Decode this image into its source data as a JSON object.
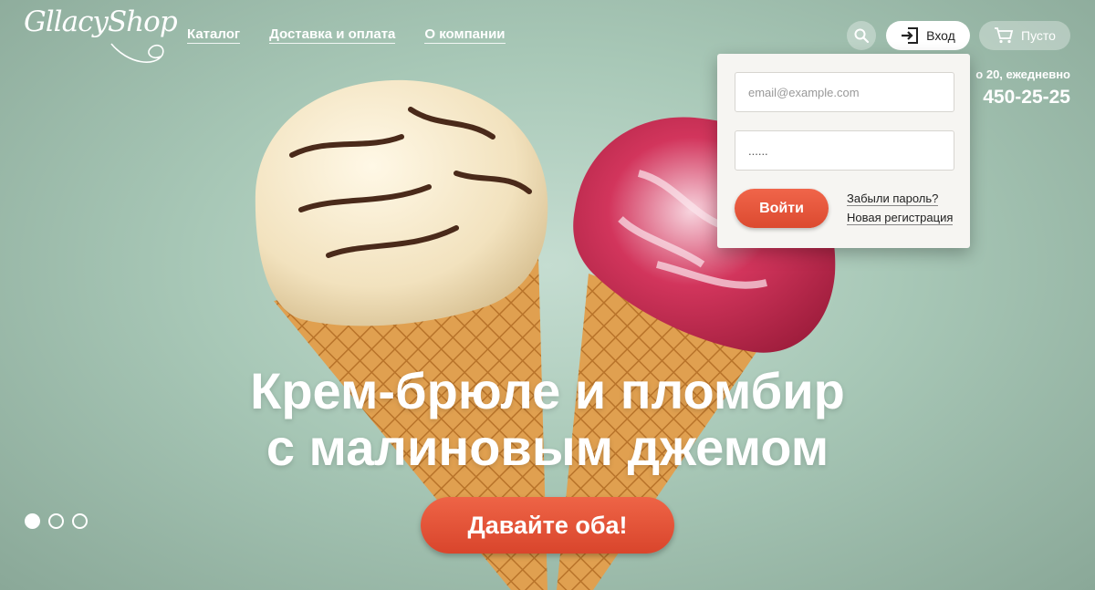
{
  "logo": {
    "text": "GllacyShop"
  },
  "nav": {
    "items": [
      {
        "label": "Каталог"
      },
      {
        "label": "Доставка и оплата"
      },
      {
        "label": "О компании"
      }
    ]
  },
  "header": {
    "search_icon": "search-icon",
    "login_label": "Вход",
    "login_icon": "sign-in-icon",
    "cart_label": "Пусто",
    "cart_icon": "cart-icon"
  },
  "contacts": {
    "hours": "о 20, ежедневно",
    "phone": "450-25-25"
  },
  "login_form": {
    "email_placeholder": "email@example.com",
    "password_value": "......",
    "submit_label": "Войти",
    "forgot_label": "Забыли пароль?",
    "register_label": "Новая регистрация"
  },
  "hero": {
    "headline_line1": "Крем-брюле и пломбир",
    "headline_line2": "с малиновым джемом",
    "cta_label": "Давайте оба!",
    "slides_total": 3,
    "active_slide": 1
  },
  "colors": {
    "background": "#a8c8b7",
    "accent": "#e4543a",
    "panel": "#f6f5f2"
  }
}
